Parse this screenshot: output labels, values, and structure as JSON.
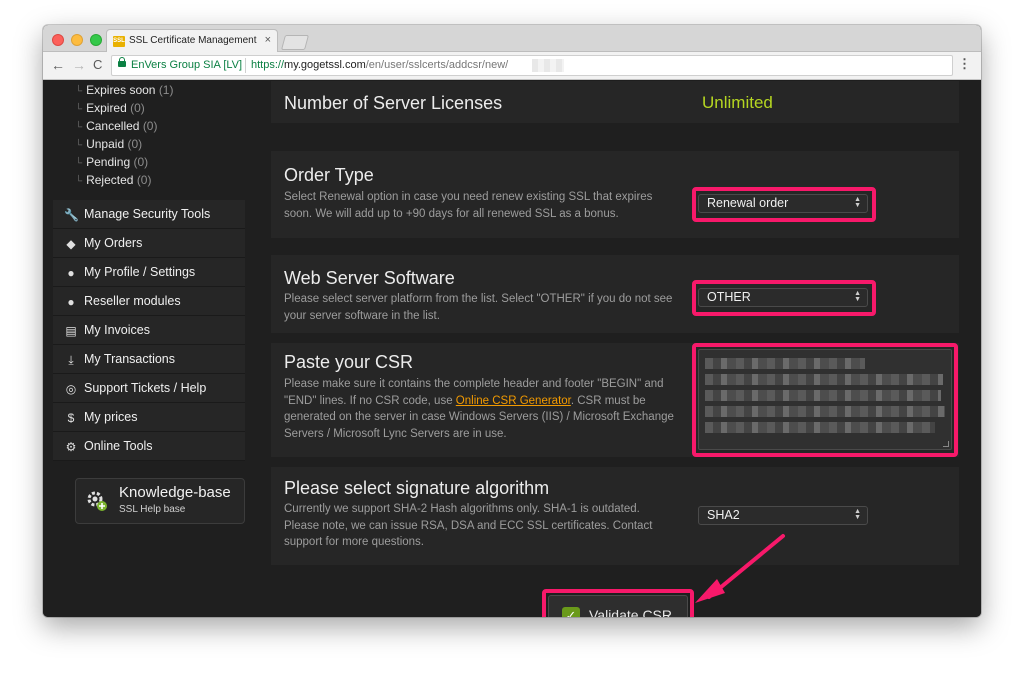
{
  "browser": {
    "tab_title": "SSL Certificate Management S",
    "tab_close": "×",
    "favicon_text": "SSL",
    "org_name": "EnVers Group SIA [LV]",
    "url_scheme": "https://",
    "url_host": "my.gogetssl.com",
    "url_path": "/en/user/sslcerts/addcsr/new/",
    "back": "←",
    "forward": "→",
    "reload": "C",
    "menu": "⋮"
  },
  "sidebar": {
    "sub_items": [
      {
        "label": "Expires soon",
        "count": "(1)"
      },
      {
        "label": "Expired",
        "count": "(0)"
      },
      {
        "label": "Cancelled",
        "count": "(0)"
      },
      {
        "label": "Unpaid",
        "count": "(0)"
      },
      {
        "label": "Pending",
        "count": "(0)"
      },
      {
        "label": "Rejected",
        "count": "(0)"
      }
    ],
    "menu": [
      {
        "label": "Manage Security Tools",
        "icon": "wrench-icon",
        "glyph": "🔧"
      },
      {
        "label": "My Orders",
        "icon": "tag-icon",
        "glyph": "◆"
      },
      {
        "label": "My Profile / Settings",
        "icon": "user-icon",
        "glyph": "●"
      },
      {
        "label": "Reseller modules",
        "icon": "users-icon",
        "glyph": "●"
      },
      {
        "label": "My Invoices",
        "icon": "document-icon",
        "glyph": "▤"
      },
      {
        "label": "My Transactions",
        "icon": "download-icon",
        "glyph": "⤓"
      },
      {
        "label": "Support Tickets / Help",
        "icon": "lifebuoy-icon",
        "glyph": "◎"
      },
      {
        "label": "My prices",
        "icon": "dollar-icon",
        "glyph": "$"
      },
      {
        "label": "Online Tools",
        "icon": "gear-icon",
        "glyph": "⚙"
      }
    ],
    "knowledge": {
      "title": "Knowledge-base",
      "subtitle": "SSL Help base"
    }
  },
  "form": {
    "licenses": {
      "title": "Number of Server Licenses",
      "value": "Unlimited"
    },
    "order_type": {
      "title": "Order Type",
      "desc": "Select Renewal option in case you need renew existing SSL that expires soon. We will add up to +90 days for all renewed SSL as a bonus.",
      "selected": "Renewal order"
    },
    "server_software": {
      "title": "Web Server Software",
      "desc": "Please select server platform from the list. Select \"OTHER\" if you do not see your server software in the list.",
      "selected": "OTHER"
    },
    "csr": {
      "title": "Paste your CSR",
      "desc_before": "Please make sure it contains the complete header and footer \"BEGIN\" and \"END\" lines. If no CSR code, use ",
      "link": "Online CSR Generator",
      "desc_after": ". CSR must be generated on the server in case Windows Servers (IIS) / Microsoft Exchange Servers / Microsoft Lync Servers are in use."
    },
    "signature": {
      "title": "Please select signature algorithm",
      "desc": "Currently we support SHA-2 Hash algorithms only. SHA-1 is outdated. Please note, we can issue RSA, DSA and ECC SSL certificates. Contact support for more questions.",
      "selected": "SHA2"
    },
    "validate_label": "Validate CSR",
    "validate_check": "✓"
  },
  "colors": {
    "highlight": "#f7196a",
    "accent_green": "#b5d621",
    "link_orange": "#f29a00"
  }
}
